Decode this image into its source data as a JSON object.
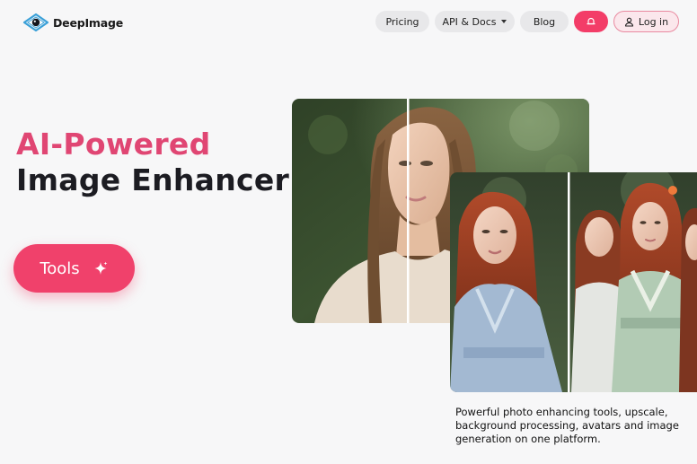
{
  "brand": {
    "name": "DeepImage"
  },
  "nav": {
    "items": [
      {
        "label": "Pricing"
      },
      {
        "label": "API & Docs"
      },
      {
        "label": "Blog"
      }
    ],
    "notify_icon": "bell-icon",
    "login_label": "Log in",
    "login_icon": "user-icon"
  },
  "hero": {
    "title_accent": "AI-Powered",
    "title_main": "Image Enhancer",
    "tools_label": "Tools",
    "tools_icon": "sparkle-icon",
    "accent_color": "#f0416b"
  },
  "caption": {
    "text": "Powerful photo enhancing tools, upscale, background processing, avatars and image generation on one platform."
  }
}
